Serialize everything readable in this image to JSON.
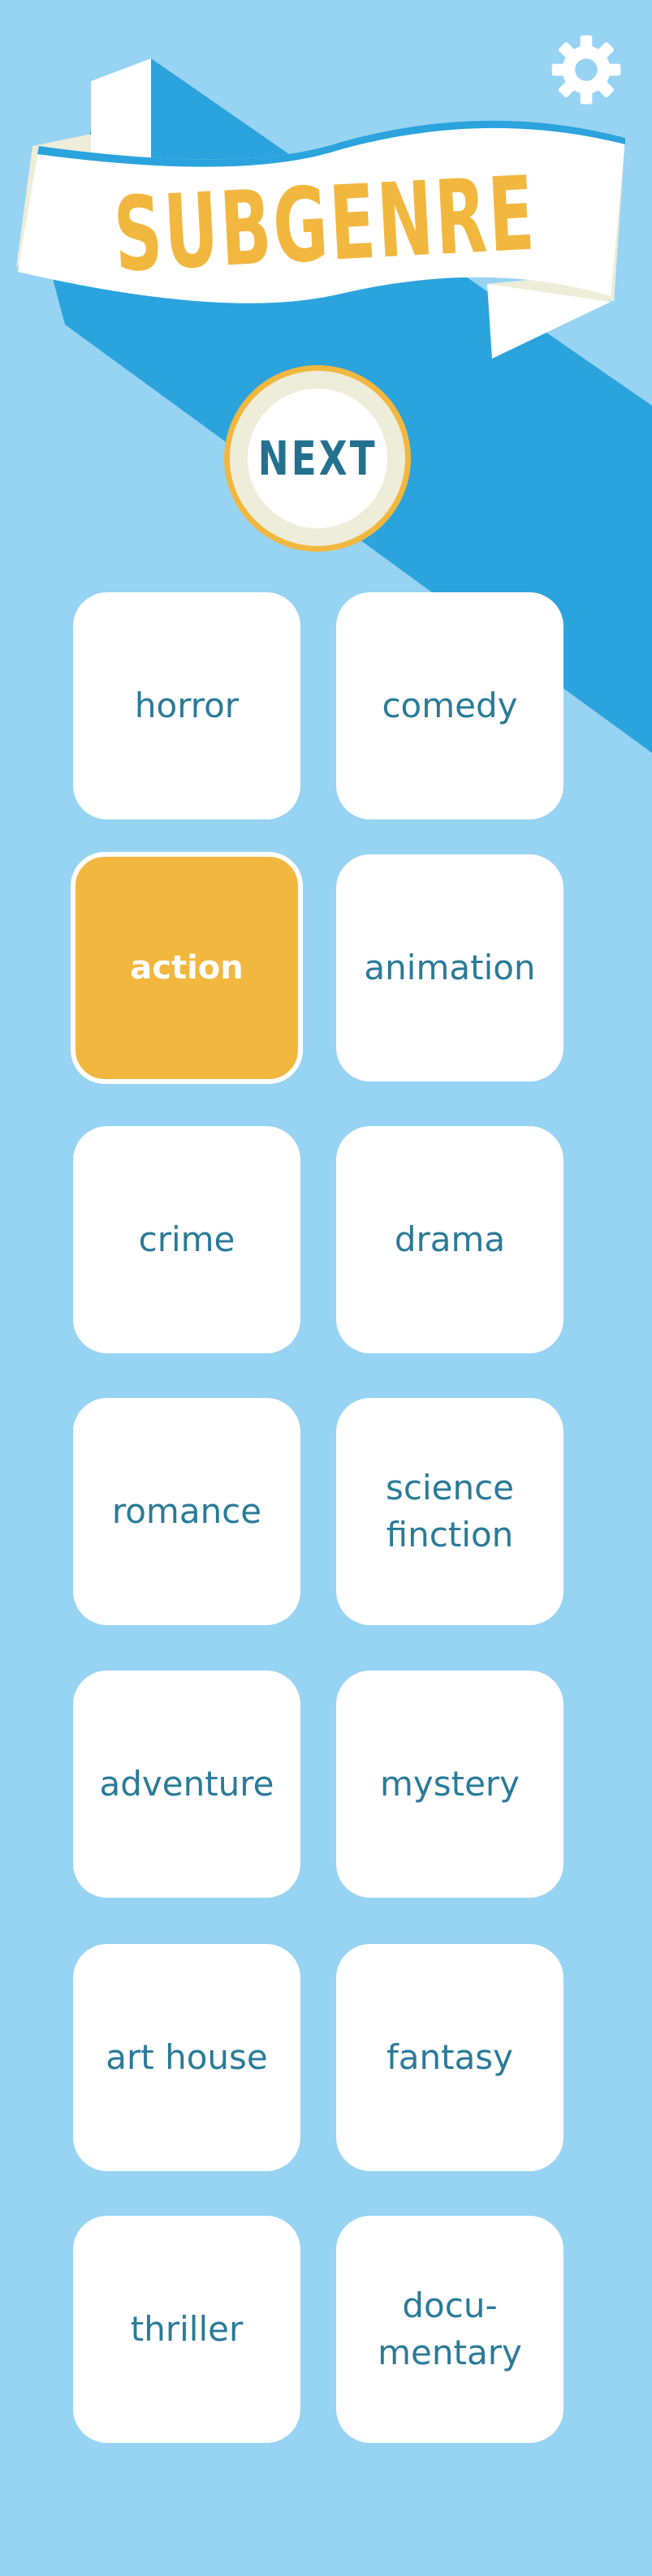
{
  "header": {
    "title": "SUBGENRE",
    "settings_icon": "gear-icon"
  },
  "next_button": {
    "label": "NEXT"
  },
  "genres": [
    {
      "label": "horror",
      "selected": false
    },
    {
      "label": "comedy",
      "selected": false
    },
    {
      "label": "action",
      "selected": true
    },
    {
      "label": "animation",
      "selected": false
    },
    {
      "label": "crime",
      "selected": false
    },
    {
      "label": "drama",
      "selected": false
    },
    {
      "label": "romance",
      "selected": false
    },
    {
      "label": "science\nfinction",
      "selected": false
    },
    {
      "label": "adventure",
      "selected": false
    },
    {
      "label": "mystery",
      "selected": false
    },
    {
      "label": "art house",
      "selected": false
    },
    {
      "label": "fantasy",
      "selected": false
    },
    {
      "label": "thriller",
      "selected": false
    },
    {
      "label": "docu-\nmentary",
      "selected": false
    }
  ],
  "colors": {
    "background": "#97d3f3",
    "accent_blue": "#2ba3dd",
    "accent_yellow": "#f2b73e",
    "text_blue": "#2a7a98",
    "cream": "#eeedda"
  }
}
